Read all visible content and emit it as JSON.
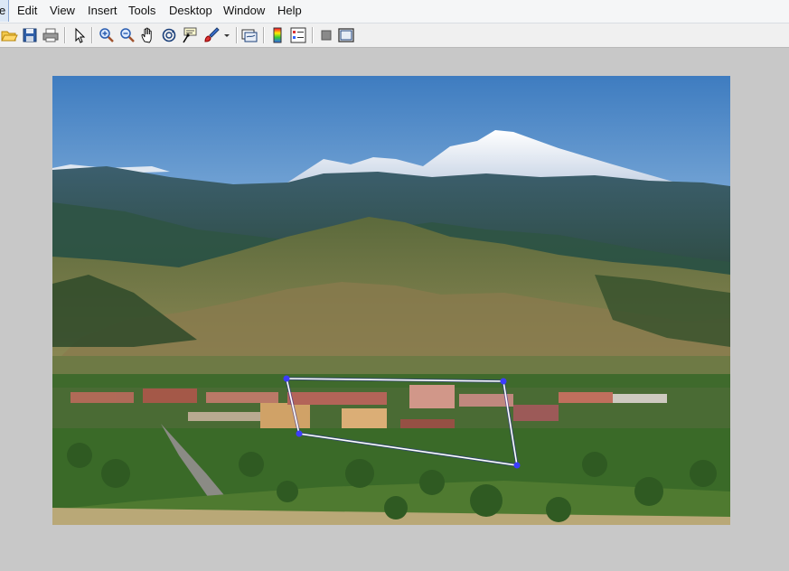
{
  "menubar": {
    "first_partial": "e",
    "items": [
      "Edit",
      "View",
      "Insert",
      "Tools",
      "Desktop",
      "Window",
      "Help"
    ]
  },
  "toolbar": {
    "buttons": [
      {
        "name": "open-file-icon"
      },
      {
        "name": "save-icon"
      },
      {
        "name": "print-icon"
      },
      {
        "name": "edit-plot-arrow-icon"
      },
      {
        "name": "zoom-in-icon"
      },
      {
        "name": "zoom-out-icon"
      },
      {
        "name": "pan-hand-icon"
      },
      {
        "name": "rotate-3d-icon"
      },
      {
        "name": "data-cursor-icon"
      },
      {
        "name": "brush-icon"
      },
      {
        "name": "brush-dropdown-icon"
      },
      {
        "name": "link-plot-icon"
      },
      {
        "name": "colorbar-icon"
      },
      {
        "name": "legend-icon"
      },
      {
        "name": "hide-plot-tools-icon"
      },
      {
        "name": "show-plot-tools-icon"
      }
    ]
  },
  "colors": {
    "window_bg": "#c8c8c8",
    "roi_line": "#ffffff",
    "roi_vertex": "#3c3cff"
  },
  "figure": {
    "image_subject": "mountain landscape with campus buildings",
    "roi_polygon": {
      "vertex_count": 4
    }
  }
}
